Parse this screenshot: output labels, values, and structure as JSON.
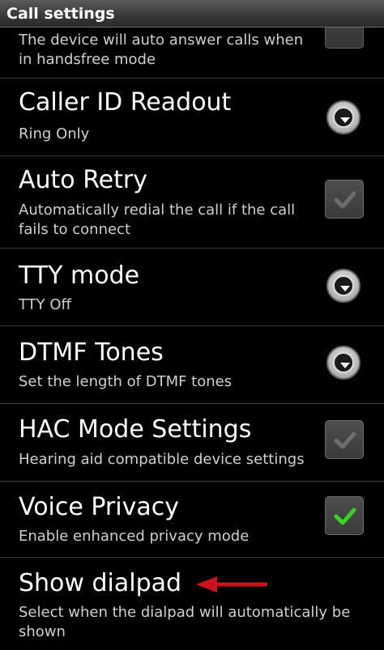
{
  "header": {
    "title": "Call settings"
  },
  "items": [
    {
      "summary": "The device will auto answer calls when in handsfree mode",
      "control": "checkbox",
      "checked": false
    },
    {
      "title": "Caller ID Readout",
      "summary": "Ring Only",
      "control": "dropdown"
    },
    {
      "title": "Auto Retry",
      "summary": "Automatically redial the call if the call fails to connect",
      "control": "checkbox",
      "checked": true,
      "enabled": false
    },
    {
      "title": "TTY mode",
      "summary": "TTY Off",
      "control": "dropdown"
    },
    {
      "title": "DTMF Tones",
      "summary": "Set the length of DTMF tones",
      "control": "dropdown"
    },
    {
      "title": "HAC Mode Settings",
      "summary": "Hearing aid compatible device settings",
      "control": "checkbox",
      "checked": true,
      "enabled": false
    },
    {
      "title": "Voice Privacy",
      "summary": "Enable enhanced privacy mode",
      "control": "checkbox",
      "checked": true,
      "enabled": true
    },
    {
      "title": "Show dialpad",
      "summary": "Select when the dialpad will automatically be shown",
      "control": "none"
    }
  ],
  "colors": {
    "check_active": "#39d12a",
    "check_disabled": "#6e6e6e",
    "arrow": "#c8141e"
  },
  "annotation": {
    "arrow_icon": "red-left-arrow-icon"
  }
}
